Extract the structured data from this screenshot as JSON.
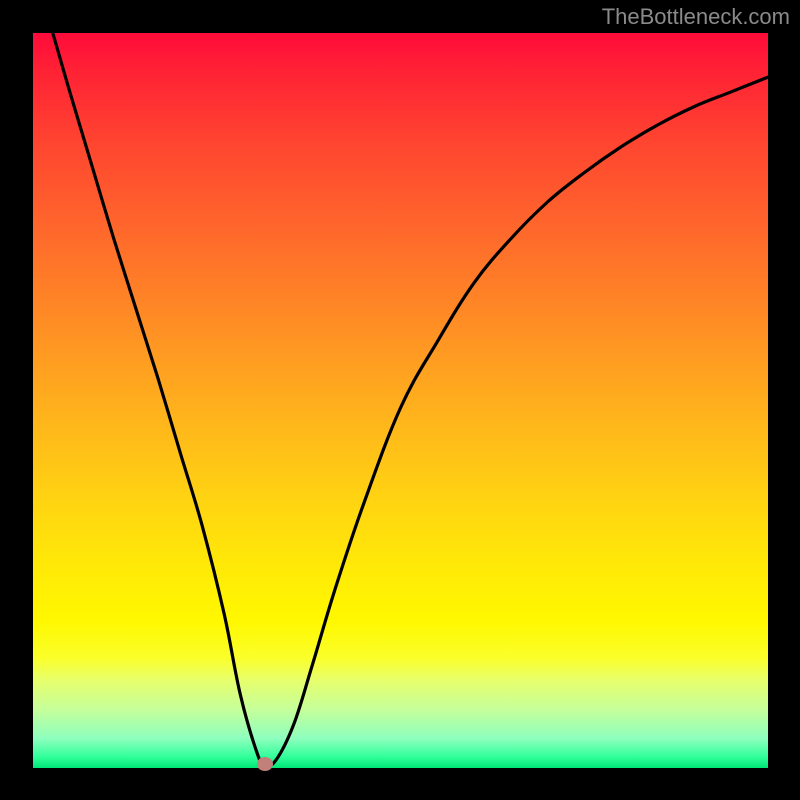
{
  "watermark": "TheBottleneck.com",
  "chart_data": {
    "type": "line",
    "title": "",
    "xlabel": "",
    "ylabel": "",
    "xlim": [
      0,
      100
    ],
    "ylim": [
      0,
      100
    ],
    "grid": false,
    "legend": false,
    "gradient_stops": [
      {
        "offset": 0,
        "color": "#ff0b3a"
      },
      {
        "offset": 15,
        "color": "#ff4530"
      },
      {
        "offset": 40,
        "color": "#ff8f24"
      },
      {
        "offset": 63,
        "color": "#ffd212"
      },
      {
        "offset": 80,
        "color": "#fff800"
      },
      {
        "offset": 92,
        "color": "#c6ff9a"
      },
      {
        "offset": 100,
        "color": "#00e676"
      }
    ],
    "series": [
      {
        "name": "bottleneck-curve",
        "x": [
          2.7,
          5,
          8,
          11,
          14,
          17,
          20,
          23,
          26,
          28.2,
          30.5,
          31.5,
          33,
          35.5,
          38,
          41,
          45,
          50,
          55,
          60,
          65,
          70,
          75,
          80,
          85,
          90,
          95,
          100
        ],
        "y": [
          100,
          92,
          82,
          72,
          62.5,
          53,
          43,
          33,
          21,
          10,
          2,
          0.5,
          1,
          6,
          14,
          24,
          36,
          49,
          58,
          66,
          72,
          77,
          81,
          84.5,
          87.5,
          90,
          92,
          94
        ]
      }
    ],
    "marker": {
      "x": 31.5,
      "y": 0.5,
      "color": "#c18079"
    },
    "background": "#000000",
    "curve_stroke": "#000000"
  }
}
